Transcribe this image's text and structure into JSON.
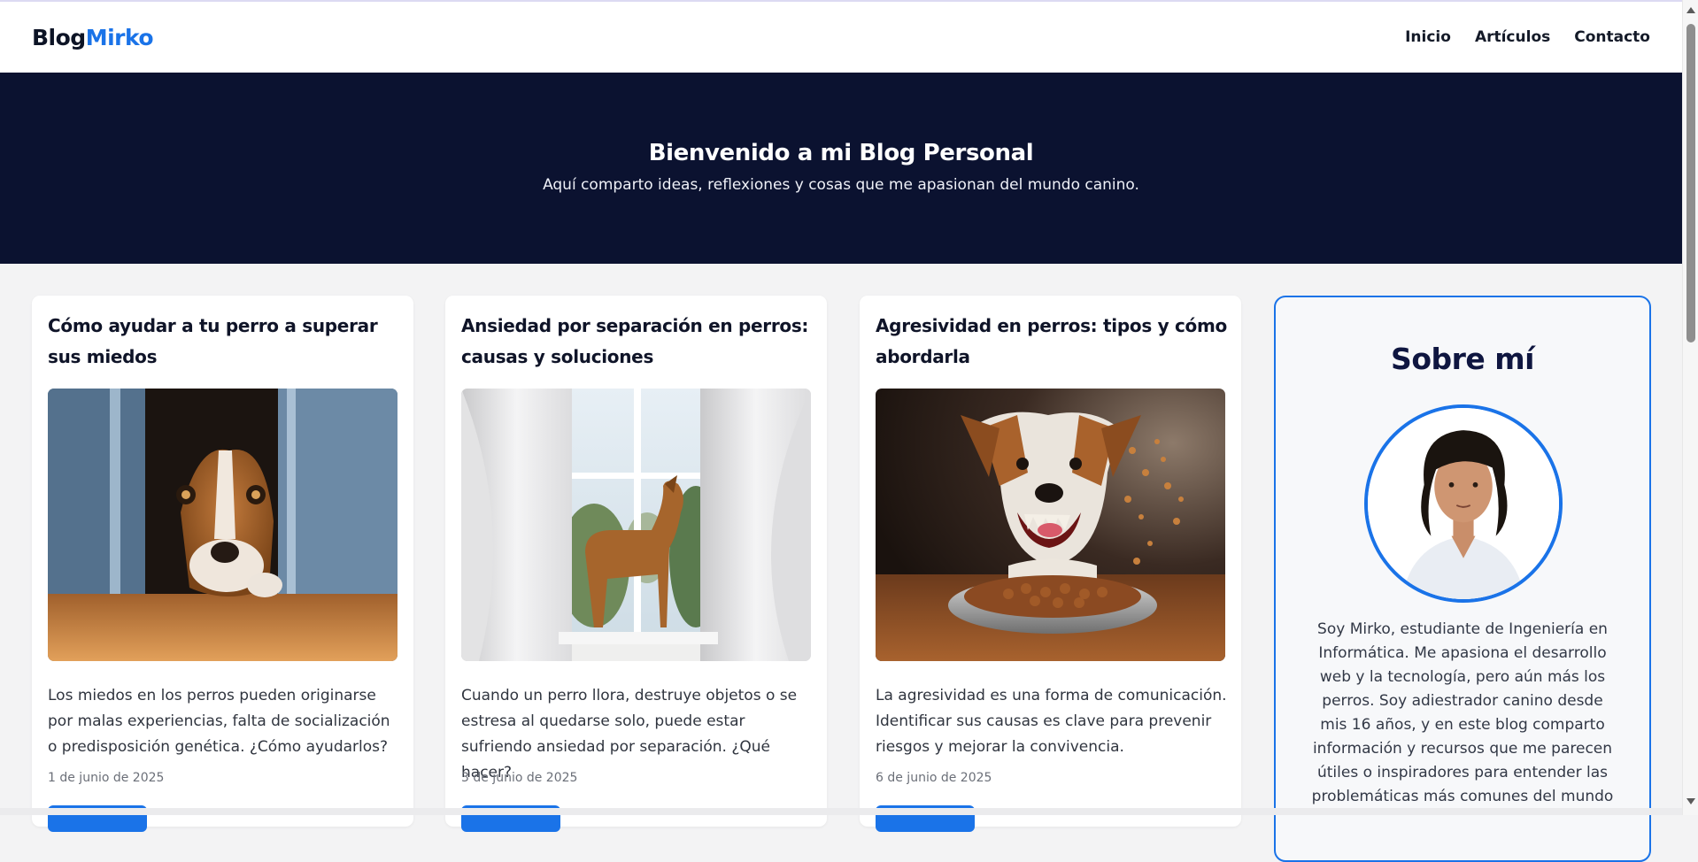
{
  "header": {
    "logo_primary": "Blog",
    "logo_accent": "Mirko",
    "nav": [
      {
        "label": "Inicio"
      },
      {
        "label": "Artículos"
      },
      {
        "label": "Contacto"
      }
    ]
  },
  "hero": {
    "title": "Bienvenido a mi Blog Personal",
    "subtitle": "Aquí comparto ideas, reflexiones y cosas que me apasionan del mundo canino."
  },
  "posts": [
    {
      "title": "Cómo ayudar a tu perro a superar sus miedos",
      "image_icon": "scared-dog-behind-door-image",
      "excerpt": "Los miedos en los perros pueden originarse por malas experiencias, falta de socialización o predisposición genética. ¿Cómo ayudarlos?",
      "date": "1 de junio de 2025"
    },
    {
      "title": "Ansiedad por separación en perros: causas y soluciones",
      "image_icon": "dog-at-window-image",
      "excerpt": "Cuando un perro llora, destruye objetos o se estresa al quedarse solo, puede estar sufriendo ansiedad por separación. ¿Qué hacer?",
      "date": "3 de junio de 2025"
    },
    {
      "title": "Agresividad en perros: tipos y cómo abordarla",
      "image_icon": "aggressive-dog-food-bowl-image",
      "excerpt": "La agresividad es una forma de comunicación. Identificar sus causas es clave para prevenir riesgos y mejorar la convivencia.",
      "date": "6 de junio de 2025"
    }
  ],
  "about": {
    "title": "Sobre mí",
    "bio": "Soy Mirko, estudiante de Ingeniería en Informática. Me apasiona el desarrollo web y la tecnología, pero aún más los perros. Soy adiestrador canino desde mis 16 años, y en este blog comparto información y recursos que me parecen útiles o inspiradores para entender las problemáticas más comunes del mundo"
  },
  "colors": {
    "accent": "#1a73e8",
    "hero_bg": "#0b1230",
    "page_bg": "#f3f3f4"
  }
}
